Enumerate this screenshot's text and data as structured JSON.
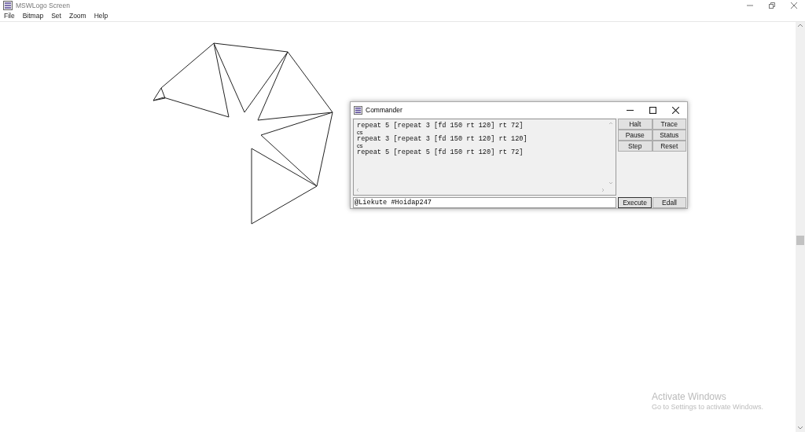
{
  "window": {
    "title": "MSWLogo Screen"
  },
  "menu": [
    "File",
    "Bitmap",
    "Set",
    "Zoom",
    "Help"
  ],
  "commander": {
    "title": "Commander",
    "history": [
      "repeat 5 [repeat 3 [fd 150 rt 120] rt 72]",
      "cs",
      "repeat 3 [repeat 3 [fd 150 rt 120] rt 120]",
      "cs",
      "repeat 5 [repeat 5 [fd 150 rt 120] rt 72]"
    ],
    "input": {
      "value": "@Liekute #Hoidap247"
    },
    "buttons": [
      "Halt",
      "Trace",
      "Pause",
      "Status",
      "Step",
      "Reset"
    ],
    "bottom_buttons": [
      {
        "label": "Execute",
        "default": true
      },
      {
        "label": "Edall",
        "default": false
      }
    ]
  },
  "watermark": {
    "title": "Activate Windows",
    "subtitle": "Go to Settings to activate Windows."
  }
}
